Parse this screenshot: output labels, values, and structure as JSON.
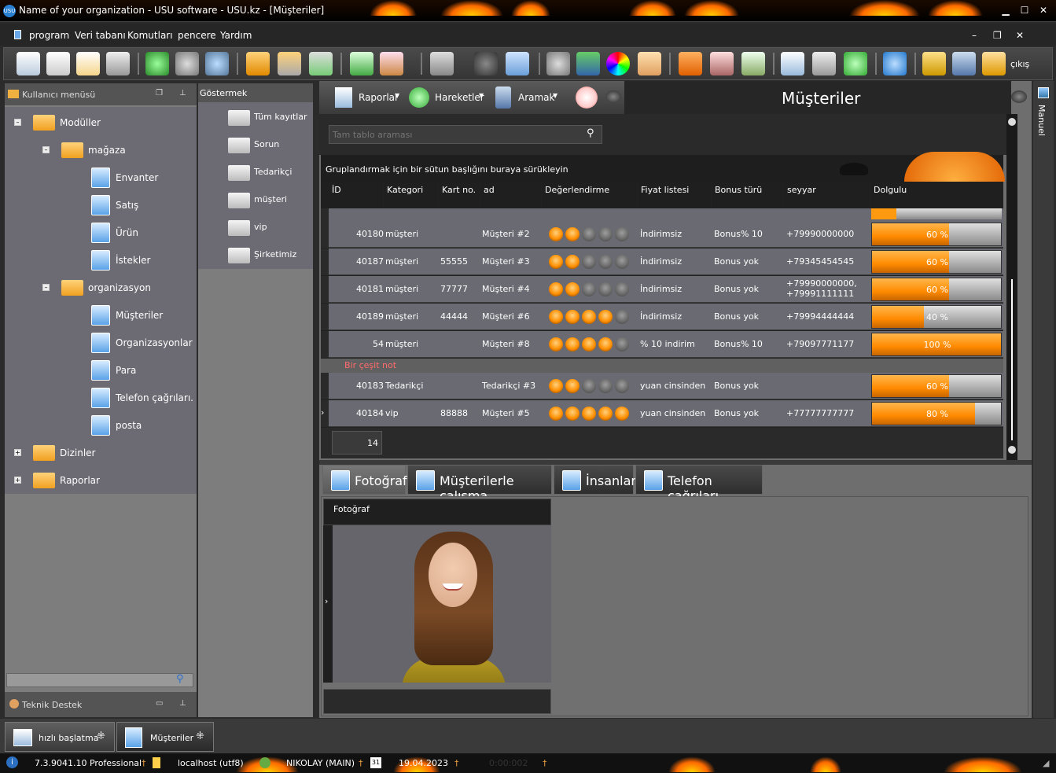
{
  "window": {
    "title": "Name of your organization - USU software - USU.kz - [Müşteriler]",
    "app_badge": "USU"
  },
  "menu": [
    "program",
    "Veri tabanı",
    "Komutları",
    "pencere",
    "Yardım"
  ],
  "toolbar": {
    "exit_label": "çıkış"
  },
  "left_panel": {
    "header": "Kullanıcı menüsü",
    "tree": {
      "moduller": "Modüller",
      "magaza": "mağaza",
      "envanter": "Envanter",
      "satis": "Satış",
      "urun": "Ürün",
      "istekler": "İstekler",
      "organizasyon": "organizasyon",
      "musteriler": "Müşteriler",
      "organizasyonlar": "Organizasyonlar",
      "para": "Para",
      "telefon": "Telefon çağrıları.",
      "posta": "posta",
      "dizinler": "Dizinler",
      "raporlar": "Raporlar"
    },
    "search_placeholder": "",
    "support_header": "Teknik Destek"
  },
  "gostermek": {
    "header": "Göstermek",
    "items": [
      "Tüm kayıtlar",
      "Sorun",
      "Tedarikçi",
      "müşteri",
      "vip",
      "Şirketimiz"
    ]
  },
  "main": {
    "toolbar": {
      "reports": "Raporlar",
      "actions": "Hareketler",
      "search": "Aramak"
    },
    "title": "Müşteriler",
    "search_placeholder": "Tam tablo araması",
    "group_hint": "Gruplandırmak için bir sütun başlığını buraya sürükleyin",
    "columns": [
      "İD",
      "Kategori",
      "Kart no.",
      "ad",
      "Değerlendirme",
      "Fiyat listesi",
      "Bonus türü",
      "seyyar",
      "Dolgulu"
    ],
    "rows": [
      {
        "id": "40180",
        "category": "müşteri",
        "card": "",
        "name": "Müşteri #2",
        "rating": 2,
        "price": "İndirimsiz",
        "bonus": "Bonus% 10",
        "mobile": "+79990000000",
        "fill": 60,
        "fill_text": "60 %"
      },
      {
        "id": "40187",
        "category": "müşteri",
        "card": "55555",
        "name": "Müşteri #3",
        "rating": 2,
        "price": "İndirimsiz",
        "bonus": "Bonus yok",
        "mobile": "+79345454545",
        "fill": 60,
        "fill_text": "60 %"
      },
      {
        "id": "40181",
        "category": "müşteri",
        "card": "77777",
        "name": "Müşteri #4",
        "rating": 2,
        "price": "İndirimsiz",
        "bonus": "Bonus yok",
        "mobile": "+79990000000,",
        "mobile2": "+79991111111",
        "fill": 60,
        "fill_text": "60 %"
      },
      {
        "id": "40189",
        "category": "müşteri",
        "card": "44444",
        "name": "Müşteri #6",
        "rating": 4,
        "price": "İndirimsiz",
        "bonus": "Bonus yok",
        "mobile": "+79994444444",
        "fill": 40,
        "fill_text": "40 %"
      },
      {
        "id": "54",
        "category": "müşteri",
        "card": "",
        "name": "Müşteri #8",
        "rating": 4,
        "price": "% 10 indirim",
        "bonus": "Bonus% 10",
        "mobile": "+79097771177",
        "fill": 100,
        "fill_text": "100 %"
      }
    ],
    "note": "Bir çeşit not",
    "rows2": [
      {
        "id": "40183",
        "category": "Tedarikçi",
        "card": "",
        "name": "Tedarikçi #3",
        "rating": 2,
        "price": "yuan cinsinden",
        "bonus": "Bonus yok",
        "mobile": "",
        "fill": 60,
        "fill_text": "60 %"
      },
      {
        "id": "40184",
        "category": "vip",
        "card": "88888",
        "name": "Müşteri #5",
        "rating": 5,
        "price": "yuan cinsinden",
        "bonus": "Bonus yok",
        "mobile": "+77777777777",
        "fill": 80,
        "fill_text": "80 %"
      }
    ],
    "count": "14",
    "tabs": [
      "Fotoğraf",
      "Müşterilerle çalışma",
      "İnsanlar",
      "Telefon çağrıları"
    ],
    "photo_header": "Fotoğraf",
    "side_label": "Manuel"
  },
  "dock": {
    "quick_start": "hızlı başlatma",
    "customers": "Müşteriler"
  },
  "status": {
    "version": "7.3.9041.10 Professional",
    "db": "localhost (utf8)",
    "user": "NIKOLAY (MAIN)",
    "date": "19.04.2023",
    "time": "0:00:002"
  }
}
